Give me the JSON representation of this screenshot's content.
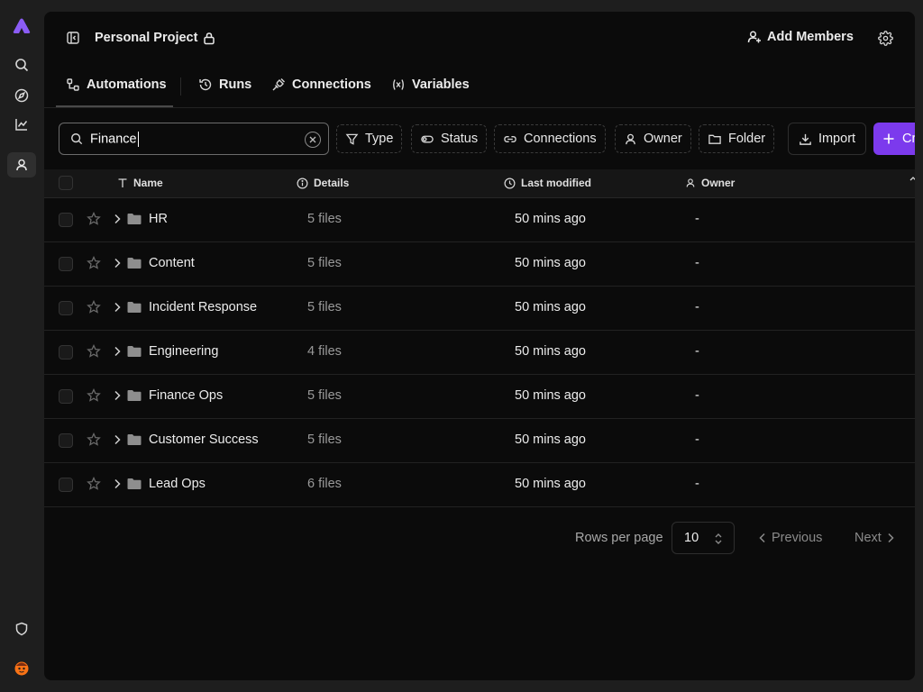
{
  "colors": {
    "accent": "#7c3aed",
    "logo": "#8b5cf6",
    "panel_bg": "#0b0b0b",
    "app_bg": "#1e1e1e"
  },
  "rail": {
    "logo_icon": "activepieces-logo",
    "items": [
      {
        "icon": "search-icon",
        "active": false
      },
      {
        "icon": "compass-icon",
        "active": false
      },
      {
        "icon": "line-chart-icon",
        "active": false
      },
      {
        "icon": "user-icon",
        "active": true
      }
    ],
    "bottom": [
      {
        "icon": "shield-icon"
      },
      {
        "icon": "avatar-emoji"
      }
    ]
  },
  "header": {
    "project_title": "Personal Project",
    "lock_icon": "lock-icon",
    "add_members_label": "Add Members"
  },
  "tabs": [
    {
      "label": "Automations",
      "icon": "flow-icon",
      "active": true
    },
    {
      "label": "Runs",
      "icon": "history-icon",
      "active": false
    },
    {
      "label": "Connections",
      "icon": "plug-icon",
      "active": false
    },
    {
      "label": "Variables",
      "icon": "variable-icon",
      "active": false
    }
  ],
  "toolbar": {
    "search_value": "Finance",
    "filters": [
      "Type",
      "Status",
      "Connections",
      "Owner",
      "Folder"
    ],
    "import_label": "Import",
    "create_label": "Cr"
  },
  "table": {
    "columns": [
      "Name",
      "Details",
      "Last modified",
      "Owner"
    ],
    "rows": [
      {
        "name": "HR",
        "details": "5 files",
        "modified": "50 mins ago",
        "owner": "-"
      },
      {
        "name": "Content",
        "details": "5 files",
        "modified": "50 mins ago",
        "owner": "-"
      },
      {
        "name": "Incident Response",
        "details": "5 files",
        "modified": "50 mins ago",
        "owner": "-"
      },
      {
        "name": "Engineering",
        "details": "4 files",
        "modified": "50 mins ago",
        "owner": "-"
      },
      {
        "name": "Finance Ops",
        "details": "5 files",
        "modified": "50 mins ago",
        "owner": "-"
      },
      {
        "name": "Customer Success",
        "details": "5 files",
        "modified": "50 mins ago",
        "owner": "-"
      },
      {
        "name": "Lead Ops",
        "details": "6 files",
        "modified": "50 mins ago",
        "owner": "-"
      }
    ]
  },
  "pagination": {
    "rows_per_page_label": "Rows per page",
    "rows_per_page_value": "10",
    "previous_label": "Previous",
    "next_label": "Next"
  }
}
